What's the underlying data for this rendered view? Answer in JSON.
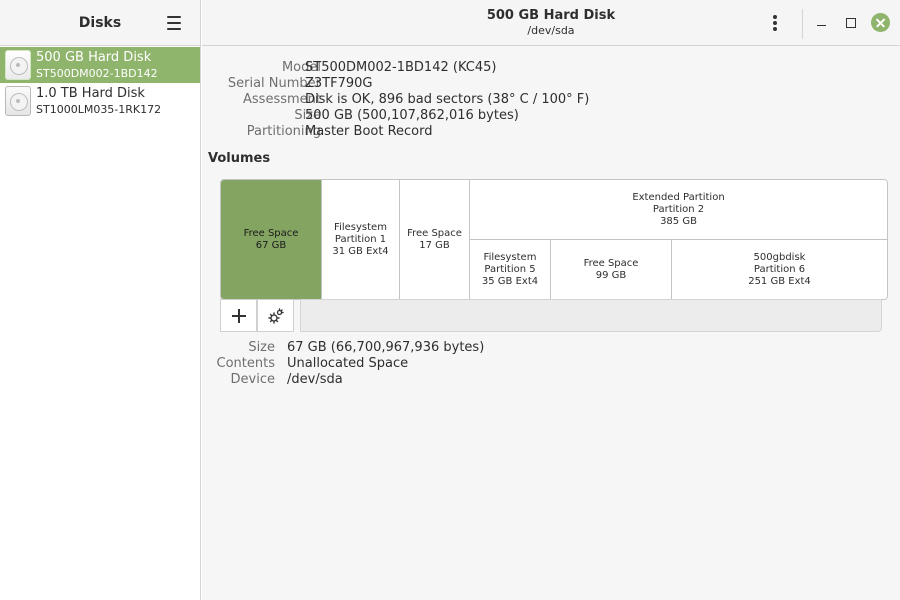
{
  "sidebar": {
    "title": "Disks",
    "disks": [
      {
        "name": "500 GB Hard Disk",
        "model": "ST500DM002-1BD142",
        "selected": true
      },
      {
        "name": "1.0 TB Hard Disk",
        "model": "ST1000LM035-1RK172",
        "selected": false
      }
    ]
  },
  "header": {
    "title": "500 GB Hard Disk",
    "subtitle": "/dev/sda"
  },
  "drive": {
    "rows": [
      {
        "label": "Model",
        "value": "ST500DM002-1BD142 (KC45)"
      },
      {
        "label": "Serial Number",
        "value": "Z3TF790G"
      },
      {
        "label": "Assessment",
        "value": "Disk is OK, 896 bad sectors (38° C / 100° F)"
      },
      {
        "label": "Size",
        "value": "500 GB (500,107,862,016 bytes)"
      },
      {
        "label": "Partitioning",
        "value": "Master Boot Record"
      }
    ]
  },
  "volumes": {
    "title": "Volumes",
    "blocks": [
      {
        "line1": "Free Space",
        "line2": "67 GB",
        "line3": "",
        "selected": true
      },
      {
        "line1": "Filesystem",
        "line2": "Partition 1",
        "line3": "31 GB Ext4"
      },
      {
        "line1": "Free Space",
        "line2": "17 GB",
        "line3": ""
      },
      {
        "line1": "Extended Partition",
        "line2": "Partition 2",
        "line3": "385 GB"
      },
      {
        "line1": "Filesystem",
        "line2": "Partition 5",
        "line3": "35 GB Ext4"
      },
      {
        "line1": "Free Space",
        "line2": "99 GB",
        "line3": ""
      },
      {
        "line1": "500gbdisk",
        "line2": "Partition 6",
        "line3": "251 GB Ext4"
      }
    ],
    "selection": [
      {
        "label": "Size",
        "value": "67 GB (66,700,967,936 bytes)"
      },
      {
        "label": "Contents",
        "value": "Unallocated Space"
      },
      {
        "label": "Device",
        "value": "/dev/sda"
      }
    ]
  },
  "colors": {
    "accent": "#8fb46c",
    "selected_volume": "#84a562"
  },
  "icons": {
    "menu": "hamburger-menu-icon",
    "more": "vertical-dots-icon",
    "add": "plus-icon",
    "options": "gears-icon",
    "disk": "hard-disk-icon"
  }
}
